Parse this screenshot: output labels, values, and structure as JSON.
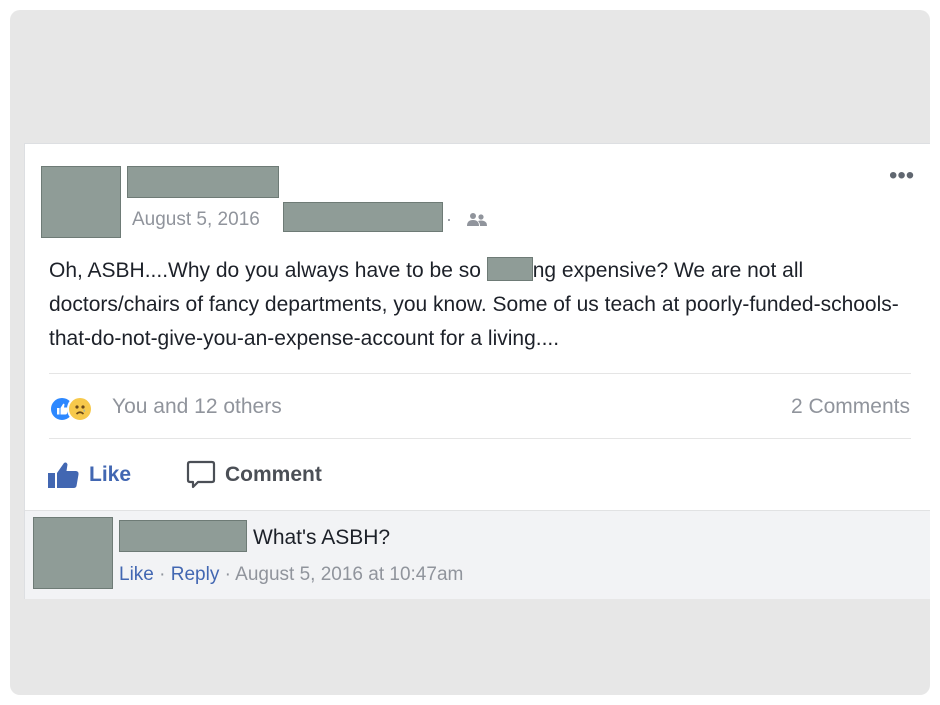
{
  "post": {
    "date": "August 5, 2016",
    "separator": "·",
    "text_before_redaction": "Oh, ASBH....Why do you always have to be so ",
    "text_after_redaction": "ng expensive? We are not all doctors/chairs of fancy departments, you know. Some of us teach at poorly-funded-schools-that-do-not-give-you-an-expense-account for a living....",
    "more_icon": "more-horizontal-icon",
    "privacy_icon": "friends-icon"
  },
  "stats": {
    "reactions_text": "You and 12 others",
    "comments_text": "2 Comments",
    "reaction_icons": [
      "like-reaction-icon",
      "sad-reaction-icon"
    ]
  },
  "actions": {
    "like_label": "Like",
    "comment_label": "Comment"
  },
  "comment": {
    "text": "What's ASBH?",
    "like_label": "Like",
    "reply_label": "Reply",
    "sep": "·",
    "timestamp": "August 5, 2016 at 10:47am"
  },
  "colors": {
    "link_blue": "#4267b2",
    "meta_gray": "#90949c",
    "text_dark": "#1d2129",
    "redaction": "#8f9c97"
  }
}
